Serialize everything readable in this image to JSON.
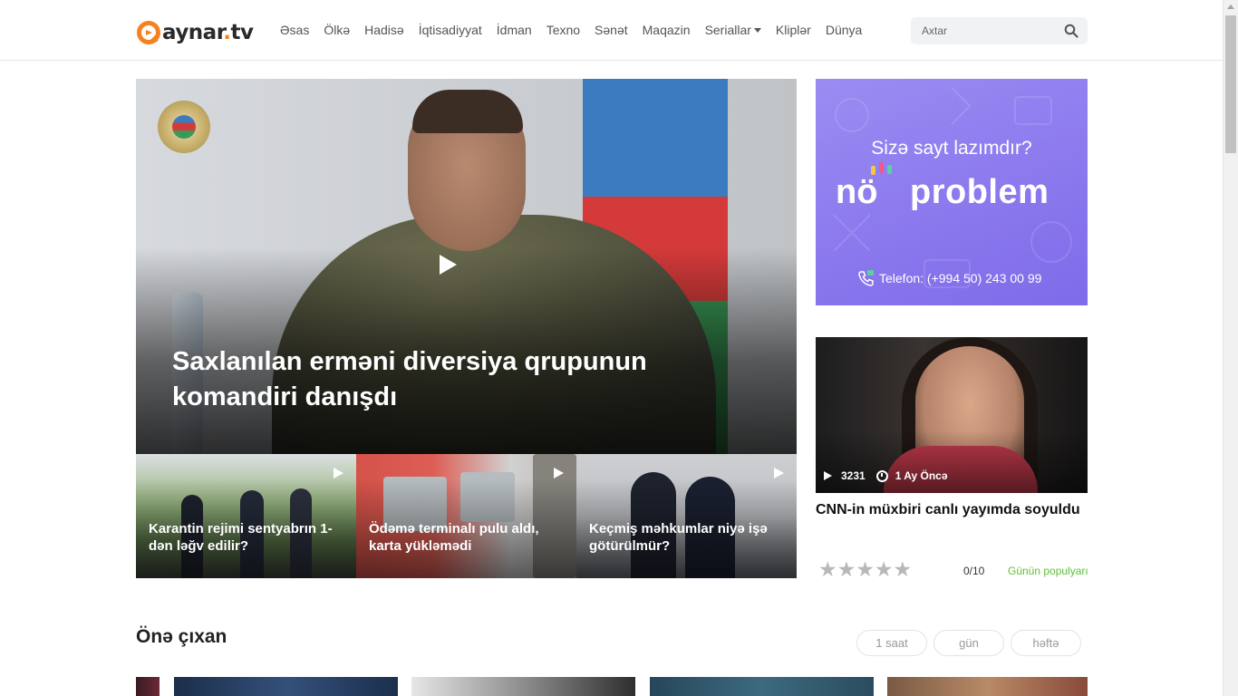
{
  "header": {
    "logo_main": "aynar",
    "logo_dot": ".",
    "logo_tld": "tv",
    "nav": [
      "Əsas",
      "Ölkə",
      "Hadisə",
      "İqtisadiyyat",
      "İdman",
      "Texno",
      "Sənət",
      "Maqazin",
      "Seriallar",
      "Kliplər",
      "Dünya"
    ],
    "search_placeholder": "Axtar",
    "accent": "#f58220"
  },
  "hero": {
    "title": "Saxlanılan erməni diversiya qrupunun komandiri danışdı"
  },
  "tiles": [
    {
      "title": "Karantin rejimi sentyabrın 1-dən ləğv edilir?"
    },
    {
      "title": "Ödəmə terminalı pulu aldı, karta yükləmədi"
    },
    {
      "title": "Keçmiş məhkumlar niyə işə götürülmür?"
    }
  ],
  "ad": {
    "question": "Sizə sayt lazımdır?",
    "brand_prefix": "nö",
    "brand": "problem",
    "phone": "Telefon: (+994 50) 243 00 99",
    "color": "#8b79ee"
  },
  "card": {
    "views": "3231",
    "time": "1 Ay Öncə",
    "title": "CNN-in müxbiri canlı yayımda soyuldu",
    "stars": "★★★★★",
    "score": "0/10",
    "popular": "Günün populyarı",
    "popular_color": "#5fc13a"
  },
  "trending": {
    "title": "Önə çıxan",
    "filters": [
      "1 saat",
      "gün",
      "həftə"
    ]
  }
}
